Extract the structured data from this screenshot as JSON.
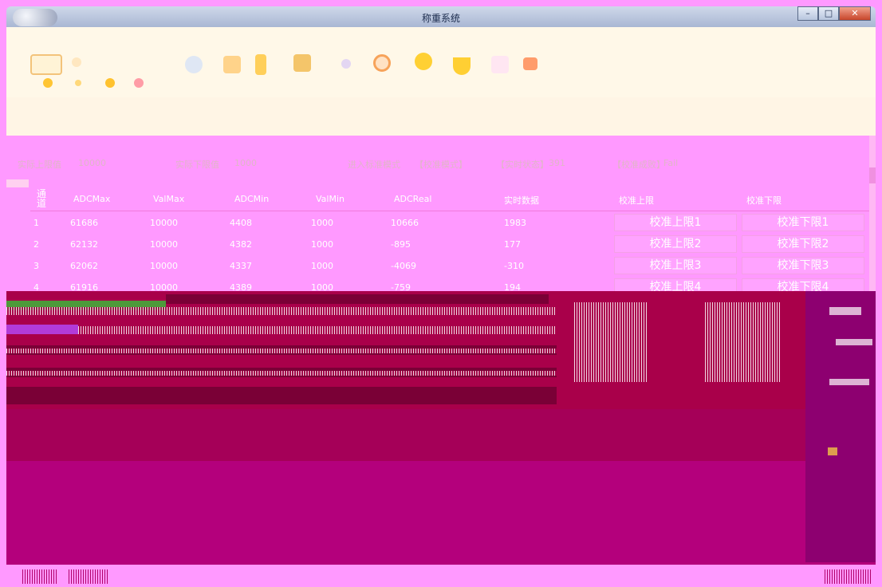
{
  "window": {
    "title": "称重系统",
    "min_label": "–",
    "max_label": "□",
    "close_label": "✕"
  },
  "ribbon": {
    "tab_label": "",
    "icons": [
      "settings-icon",
      "folder-icon",
      "export-icon",
      "star-icon",
      "circle-icon",
      "bell-icon",
      "heart-icon",
      "arrow-up-icon",
      "arrow-right-icon"
    ]
  },
  "banner": {
    "title": "",
    "subtitle": ""
  },
  "info": {
    "upper_label": "实际上限值",
    "upper_value": "10000",
    "lower_label": "实际下限值",
    "lower_value": "1000",
    "mode_label": "进入标准模式",
    "mode_value": "【校准模式】",
    "realtime_label": "【实时状态】",
    "realtime_value": "391",
    "calib_label": "【校准成败】",
    "calib_value": "Fail"
  },
  "table": {
    "columns": [
      "通道",
      "ADCMax",
      "ValMax",
      "ADCMin",
      "ValMin",
      "ADCReal",
      "实时数据",
      "校准上限",
      "校准下限"
    ],
    "rows": [
      {
        "ch": "1",
        "adcmax": "61686",
        "valmax": "10000",
        "adcmin": "4408",
        "valmin": "1000",
        "adcreal": "10666",
        "realtime": "1983",
        "btn_upper": "校准上限1",
        "btn_lower": "校准下限1"
      },
      {
        "ch": "2",
        "adcmax": "62132",
        "valmax": "10000",
        "adcmin": "4382",
        "valmin": "1000",
        "adcreal": "-895",
        "realtime": "177",
        "btn_upper": "校准上限2",
        "btn_lower": "校准下限2"
      },
      {
        "ch": "3",
        "adcmax": "62062",
        "valmax": "10000",
        "adcmin": "4337",
        "valmin": "1000",
        "adcreal": "-4069",
        "realtime": "-310",
        "btn_upper": "校准上限3",
        "btn_lower": "校准下限3"
      },
      {
        "ch": "4",
        "adcmax": "61916",
        "valmax": "10000",
        "adcmin": "4389",
        "valmin": "1000",
        "adcreal": "-759",
        "realtime": "194",
        "btn_upper": "校准上限4",
        "btn_lower": "校准下限4"
      }
    ]
  },
  "colors": {
    "background": "#ff99ff",
    "glitch_dark": "#a9004a",
    "band_low": "#b4007c"
  }
}
